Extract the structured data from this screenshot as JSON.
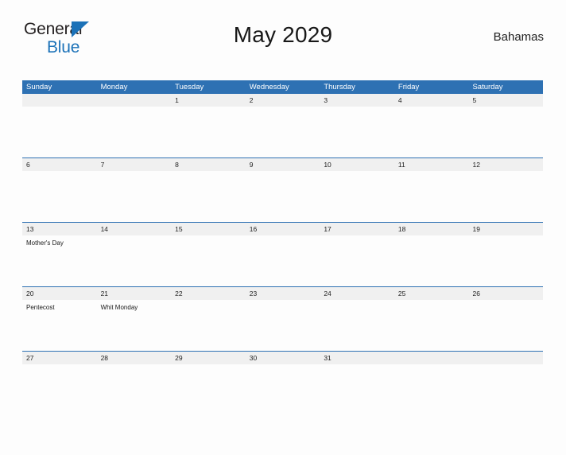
{
  "brand": {
    "line1": "General",
    "line2": "Blue",
    "triangle_color": "#1c72b8",
    "text_color": "#231f20"
  },
  "header": {
    "title": "May 2029",
    "region": "Bahamas"
  },
  "calendar": {
    "accent_color": "#2e71b3",
    "band_color": "#f0f0f0",
    "weekdays": [
      "Sunday",
      "Monday",
      "Tuesday",
      "Wednesday",
      "Thursday",
      "Friday",
      "Saturday"
    ],
    "weeks": [
      {
        "days": [
          {
            "date": "",
            "events": []
          },
          {
            "date": "",
            "events": []
          },
          {
            "date": "1",
            "events": []
          },
          {
            "date": "2",
            "events": []
          },
          {
            "date": "3",
            "events": []
          },
          {
            "date": "4",
            "events": []
          },
          {
            "date": "5",
            "events": []
          }
        ]
      },
      {
        "days": [
          {
            "date": "6",
            "events": []
          },
          {
            "date": "7",
            "events": []
          },
          {
            "date": "8",
            "events": []
          },
          {
            "date": "9",
            "events": []
          },
          {
            "date": "10",
            "events": []
          },
          {
            "date": "11",
            "events": []
          },
          {
            "date": "12",
            "events": []
          }
        ]
      },
      {
        "days": [
          {
            "date": "13",
            "events": [
              "Mother's Day"
            ]
          },
          {
            "date": "14",
            "events": []
          },
          {
            "date": "15",
            "events": []
          },
          {
            "date": "16",
            "events": []
          },
          {
            "date": "17",
            "events": []
          },
          {
            "date": "18",
            "events": []
          },
          {
            "date": "19",
            "events": []
          }
        ]
      },
      {
        "days": [
          {
            "date": "20",
            "events": [
              "Pentecost"
            ]
          },
          {
            "date": "21",
            "events": [
              "Whit Monday"
            ]
          },
          {
            "date": "22",
            "events": []
          },
          {
            "date": "23",
            "events": []
          },
          {
            "date": "24",
            "events": []
          },
          {
            "date": "25",
            "events": []
          },
          {
            "date": "26",
            "events": []
          }
        ]
      },
      {
        "days": [
          {
            "date": "27",
            "events": []
          },
          {
            "date": "28",
            "events": []
          },
          {
            "date": "29",
            "events": []
          },
          {
            "date": "30",
            "events": []
          },
          {
            "date": "31",
            "events": []
          },
          {
            "date": "",
            "events": []
          },
          {
            "date": "",
            "events": []
          }
        ]
      }
    ]
  }
}
